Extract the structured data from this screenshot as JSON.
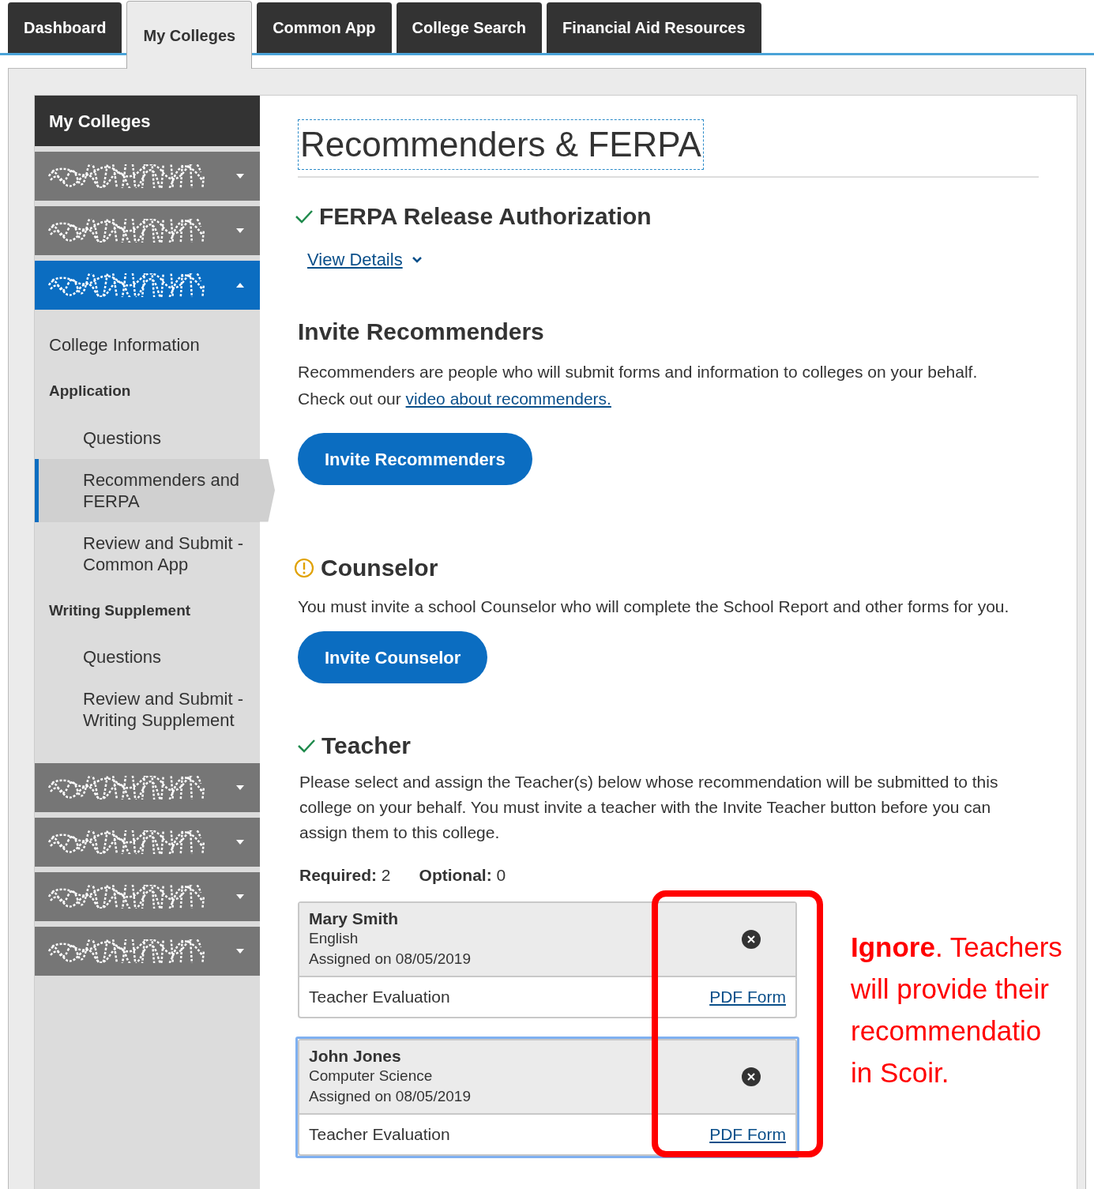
{
  "tabs": [
    {
      "label": "Dashboard",
      "selected": false
    },
    {
      "label": "My Colleges",
      "selected": true
    },
    {
      "label": "Common App",
      "selected": false
    },
    {
      "label": "College Search",
      "selected": false
    },
    {
      "label": "Financial Aid Resources",
      "selected": false
    }
  ],
  "sidebar": {
    "title": "My Colleges",
    "colleges_before": [
      {
        "expanded": false
      },
      {
        "expanded": false
      },
      {
        "expanded": true
      }
    ],
    "nav": [
      {
        "label": "College Information",
        "kind": "link",
        "selected": false
      },
      {
        "label": "Application",
        "kind": "heading",
        "children": [
          {
            "label": "Questions",
            "selected": false
          },
          {
            "label": "Recommenders and FERPA",
            "selected": true
          },
          {
            "label": "Review and Submit - Common App",
            "selected": false
          }
        ]
      },
      {
        "label": "Writing Supplement",
        "kind": "heading",
        "children": [
          {
            "label": "Questions",
            "selected": false
          },
          {
            "label": "Review and Submit - Writing Supplement",
            "selected": false
          }
        ]
      }
    ],
    "colleges_after": [
      {
        "expanded": false
      },
      {
        "expanded": false
      },
      {
        "expanded": false
      },
      {
        "expanded": false
      }
    ]
  },
  "page_title": "Recommenders & FERPA",
  "ferpa": {
    "kind": "complete",
    "heading": "FERPA Release Authorization",
    "link": "View Details"
  },
  "invite": {
    "heading": "Invite Recommenders",
    "text": "Recommenders are people who will submit forms and information to colleges on your behalf.",
    "text2": "Check out our",
    "link": "video about recommenders.",
    "button": "Invite Recommenders"
  },
  "counselor": {
    "kind": "warning",
    "heading": "Counselor",
    "text": "You must invite a school Counselor who will complete the School Report and other forms for you.",
    "button": "Invite Counselor"
  },
  "teacher": {
    "kind": "complete",
    "heading": "Teacher",
    "text": "Please select and assign the Teacher(s) below whose recommendation will be submitted to this college on your behalf. You must invite a teacher with the Invite Teacher button before you can assign them to this college.",
    "required_label": "Required:",
    "required": "2",
    "optional_label": "Optional:",
    "optional": "0",
    "teachers": [
      {
        "name": "Mary Smith",
        "subject": "English",
        "assigned": "Assigned on 08/05/2019",
        "form": "Teacher Evaluation",
        "link": "PDF Form",
        "selected": false
      },
      {
        "name": "John Jones",
        "subject": "Computer Science",
        "assigned": "Assigned on 08/05/2019",
        "form": "Teacher Evaluation",
        "link": "PDF Form",
        "selected": true
      }
    ]
  },
  "annotation": {
    "lines": [
      "**Ignore**. Teachers",
      "will provide their",
      "recommendatio",
      "in Scoir."
    ]
  }
}
